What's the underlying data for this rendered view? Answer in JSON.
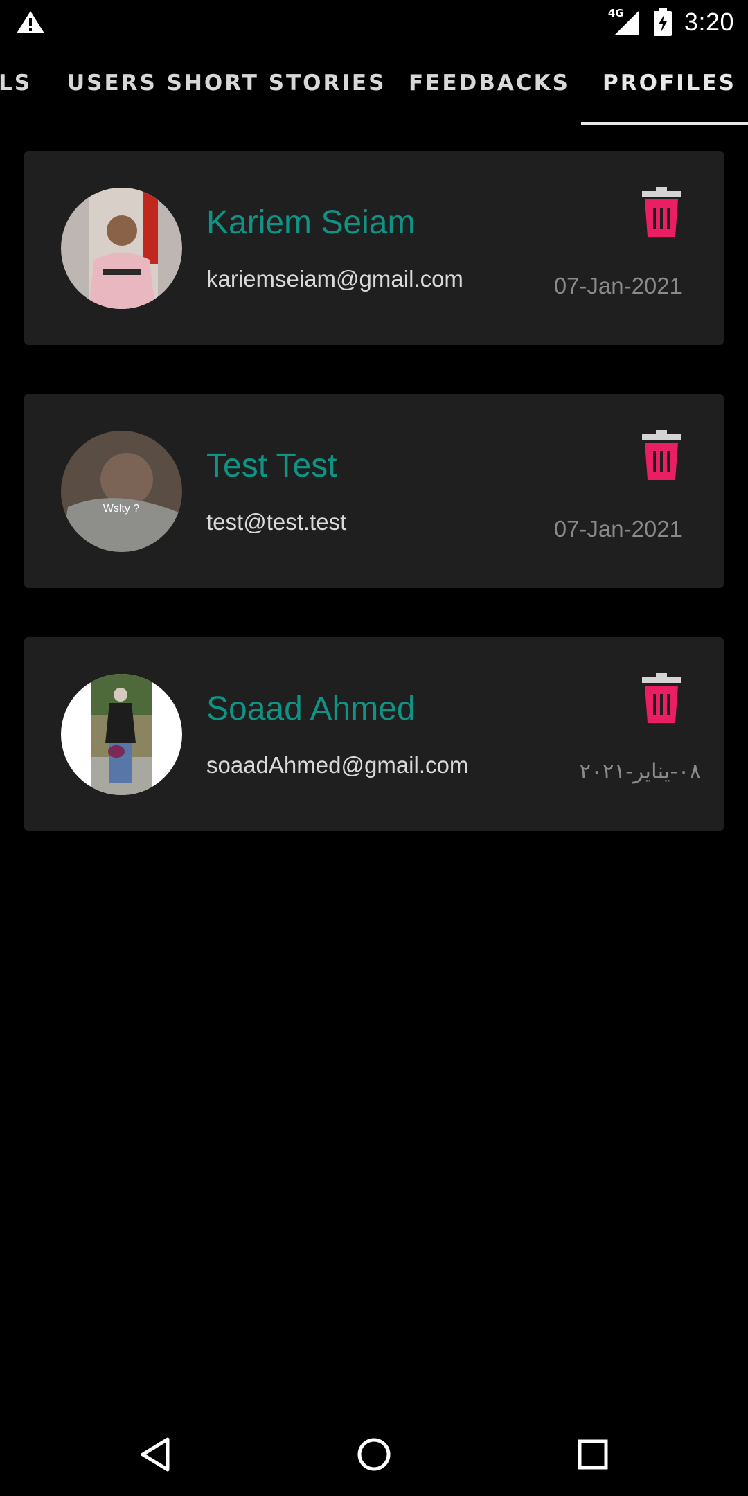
{
  "status_bar": {
    "time": "3:20",
    "network": "4G",
    "icons": [
      "alert-icon",
      "signal-icon",
      "battery-charging-icon"
    ]
  },
  "tabs": [
    {
      "label": "LS",
      "active": false
    },
    {
      "label": "USERS SHORT STORIES",
      "active": false
    },
    {
      "label": "FEEDBACKS",
      "active": false
    },
    {
      "label": "PROFILES",
      "active": true
    }
  ],
  "profiles": [
    {
      "name": "Kariem Seiam",
      "email": "kariemseiam@gmail.com",
      "date": "07-Jan-2021"
    },
    {
      "name": "Test Test",
      "email": "test@test.test",
      "date": "07-Jan-2021",
      "avatar_caption": "Wslty ?"
    },
    {
      "name": "Soaad Ahmed",
      "email": "soaadAhmed@gmail.com",
      "date": "٠٨-يناير-٢٠٢١"
    }
  ],
  "colors": {
    "background": "#000000",
    "card": "#1f1f1f",
    "name": "#0e9384",
    "delete": "#e91e63"
  },
  "nav_bar": {
    "icons": [
      "back-icon",
      "home-icon",
      "recents-icon"
    ]
  }
}
